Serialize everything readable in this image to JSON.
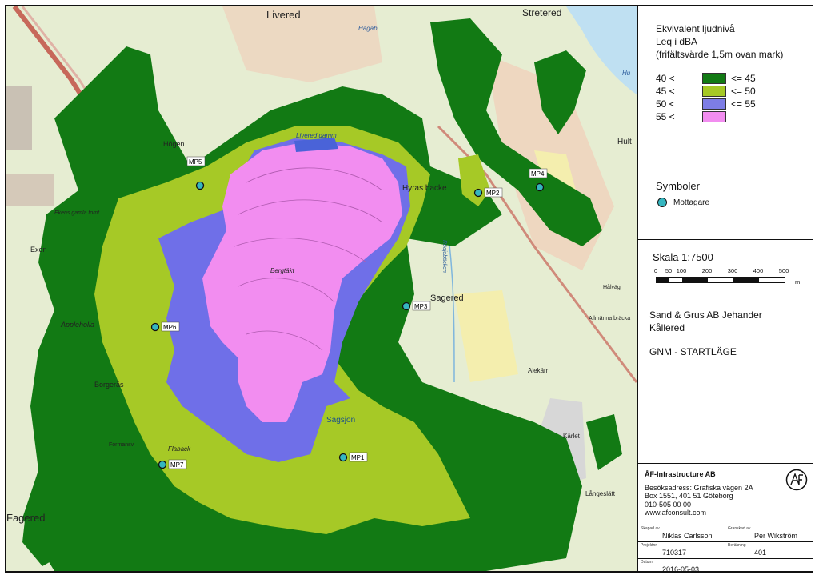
{
  "map": {
    "place_labels": [
      "Livered",
      "Stretered",
      "Hagab",
      "Högen",
      "Ekens gamla tomt",
      "Exen",
      "Äppleholla",
      "Borgerås",
      "Formansv.",
      "Flaback",
      "Fagered",
      "Bergtäkt",
      "Sagered",
      "Sagsjön",
      "Rödjebäcken",
      "Alekärr",
      "Allmänna bräcka",
      "Hålväg",
      "Långeslätt",
      "Kårlet",
      "Hu",
      "Hult",
      "Hyras backe",
      "Livered damm"
    ],
    "receivers": [
      {
        "label": "MP1"
      },
      {
        "label": "MP2"
      },
      {
        "label": "MP3"
      },
      {
        "label": "MP4"
      },
      {
        "label": "MP5"
      },
      {
        "label": "MP6"
      },
      {
        "label": "MP7"
      }
    ]
  },
  "legend": {
    "title_lines": [
      "Ekvivalent ljudnivå",
      "Leq i dBA",
      "(frifältsvärde 1,5m ovan mark)"
    ],
    "rows": [
      {
        "from": "40 <",
        "to": "<= 45",
        "color": "#127a14"
      },
      {
        "from": "45 <",
        "to": "<= 50",
        "color": "#a6c926"
      },
      {
        "from": "50 <",
        "to": "<= 55",
        "color": "#7d7de6"
      },
      {
        "from": "55 <",
        "to": "",
        "color": "#f28df0"
      }
    ]
  },
  "symbols": {
    "title": "Symboler",
    "receiver_label": "Mottagare",
    "receiver_color": "#35b6c0"
  },
  "scale": {
    "title": "Skala 1:7500",
    "ticks": [
      "0",
      "50",
      "100",
      "200",
      "300",
      "400",
      "500"
    ],
    "unit": "m"
  },
  "project": {
    "client": "Sand & Grus AB Jehander",
    "place": "Kållered",
    "scenario": "GNM - STARTLÄGE"
  },
  "company": {
    "name": "ÅF-Infrastructure AB",
    "address1": "Besöksadress: Grafiska vägen 2A",
    "address2": "Box 1551, 401 51  Göteborg",
    "phone": "010-505 00 00",
    "web": "www.afconsult.com"
  },
  "meta": {
    "created_by_key": "Skapad av",
    "created_by": "Niklas Carlsson",
    "checked_by_key": "Granskad av",
    "checked_by": "Per Wikström",
    "project_key": "Projektnr",
    "project_no": "710317",
    "calc_key": "Beräkning",
    "calc_no": "401",
    "date_key": "Datum",
    "date": "2016-05-03"
  }
}
